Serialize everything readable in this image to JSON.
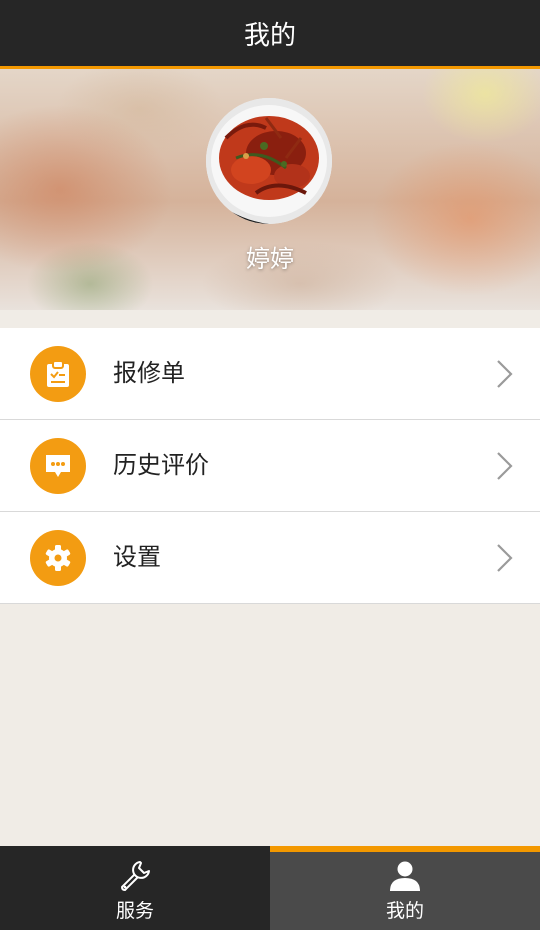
{
  "header": {
    "title": "我的"
  },
  "profile": {
    "username": "婷婷",
    "avatar_icon": "crawfish-dish-photo"
  },
  "menu": {
    "items": [
      {
        "label": "报修单",
        "icon": "clipboard-icon"
      },
      {
        "label": "历史评价",
        "icon": "chat-bubble-icon"
      },
      {
        "label": "设置",
        "icon": "gear-icon"
      }
    ]
  },
  "tabbar": {
    "tabs": [
      {
        "label": "服务",
        "icon": "wrench-icon",
        "active": false
      },
      {
        "label": "我的",
        "icon": "person-icon",
        "active": true
      }
    ]
  },
  "colors": {
    "accent": "#f39800",
    "icon_circle": "#f39c12",
    "header_bg": "#262626",
    "page_bg": "#f0ece6"
  }
}
